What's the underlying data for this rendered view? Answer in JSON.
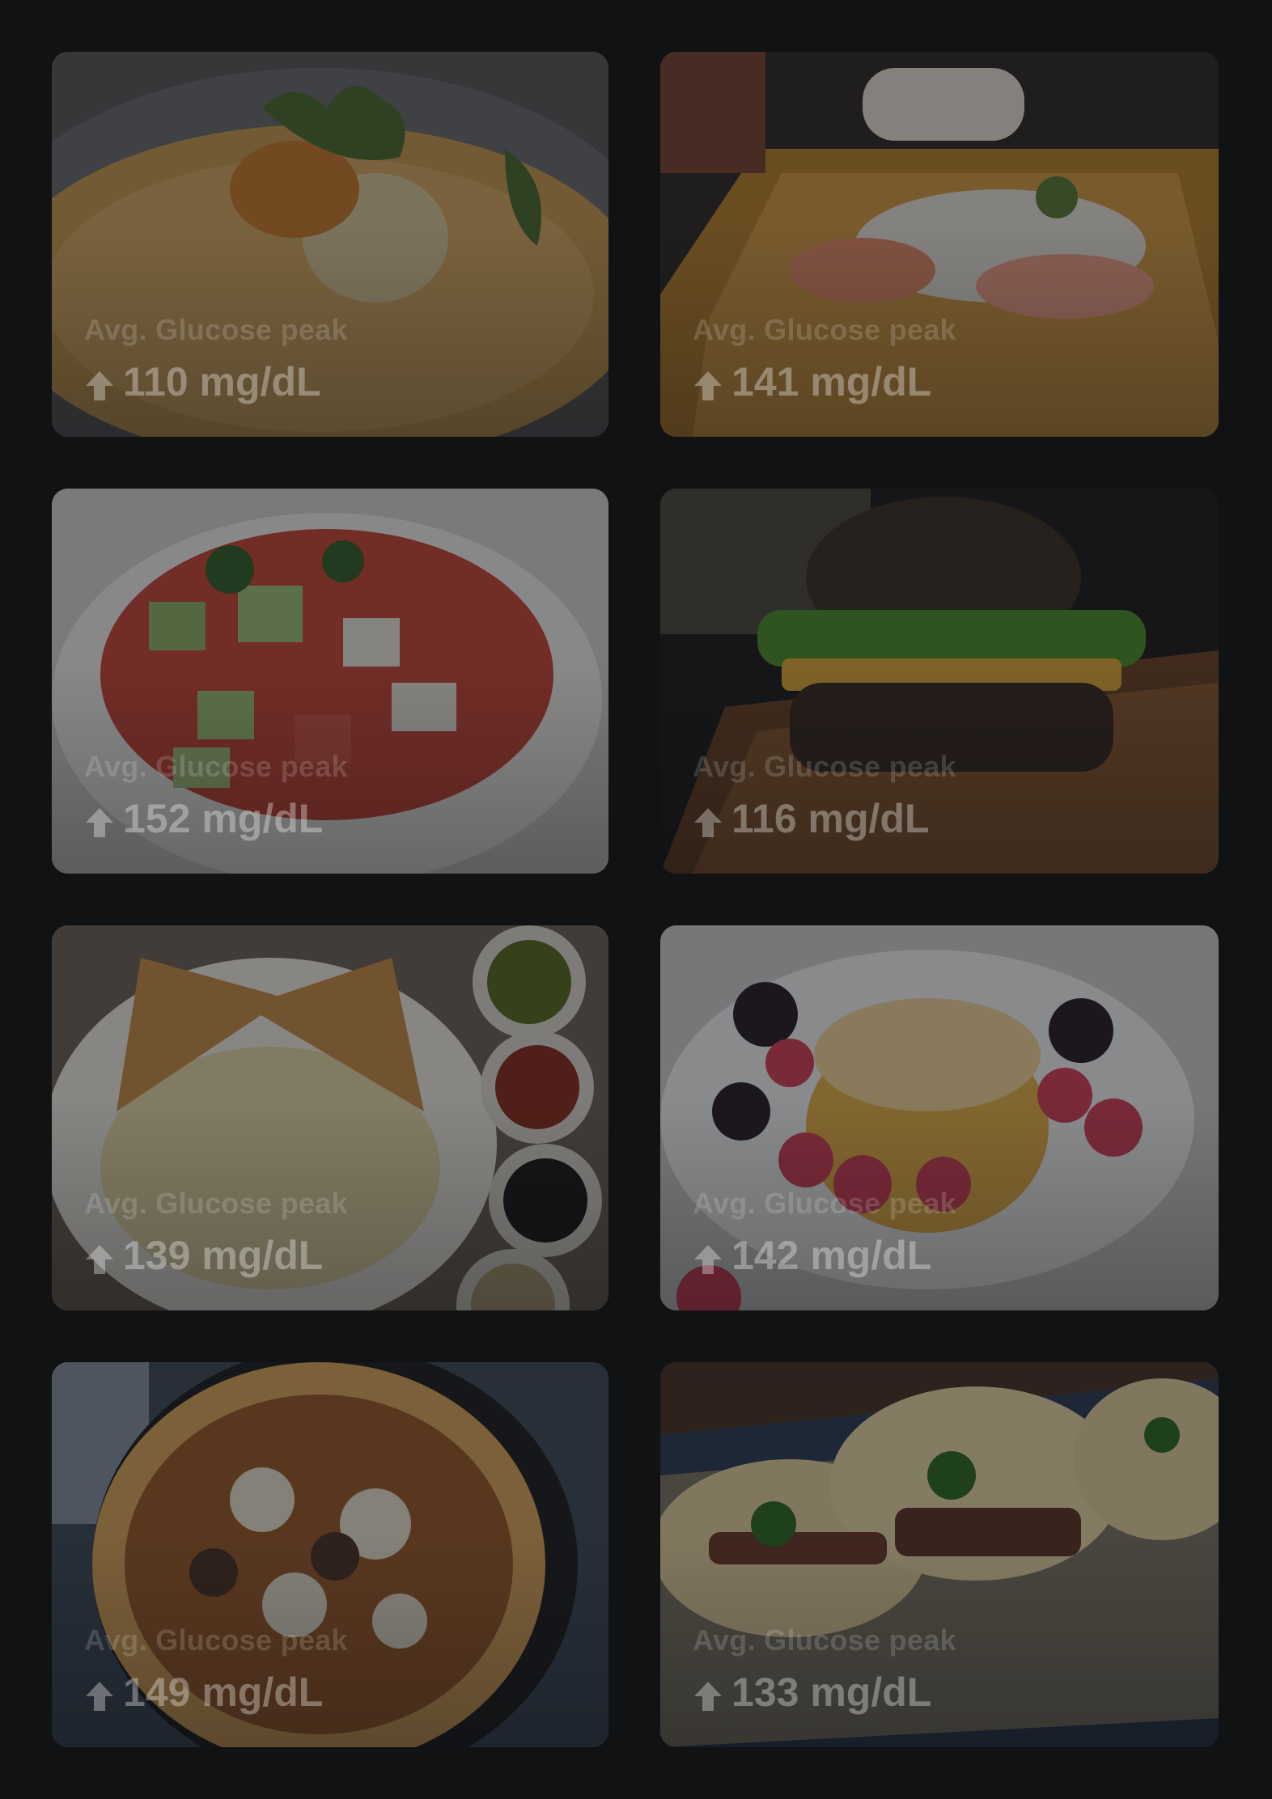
{
  "meals": [
    {
      "label": "Avg. Glucose peak",
      "value": "110 mg/dL",
      "icon": "arrow-up-icon",
      "photo": "hummus-bowl"
    },
    {
      "label": "Avg. Glucose peak",
      "value": "141 mg/dL",
      "icon": "arrow-up-icon",
      "photo": "sushi-platter"
    },
    {
      "label": "Avg. Glucose peak",
      "value": "152 mg/dL",
      "icon": "arrow-up-icon",
      "photo": "tomato-cucumber-salad"
    },
    {
      "label": "Avg. Glucose peak",
      "value": "116 mg/dL",
      "icon": "arrow-up-icon",
      "photo": "sesame-burger"
    },
    {
      "label": "Avg. Glucose peak",
      "value": "139 mg/dL",
      "icon": "arrow-up-icon",
      "photo": "pasta-with-toast"
    },
    {
      "label": "Avg. Glucose peak",
      "value": "142 mg/dL",
      "icon": "arrow-up-icon",
      "photo": "pancakes-berries"
    },
    {
      "label": "Avg. Glucose peak",
      "value": "149 mg/dL",
      "icon": "arrow-up-icon",
      "photo": "pizza"
    },
    {
      "label": "Avg. Glucose peak",
      "value": "133 mg/dL",
      "icon": "arrow-up-icon",
      "photo": "tacos"
    }
  ],
  "colors": {
    "background": "#111214",
    "overlay": "rgba(14,15,17,0.46)"
  }
}
